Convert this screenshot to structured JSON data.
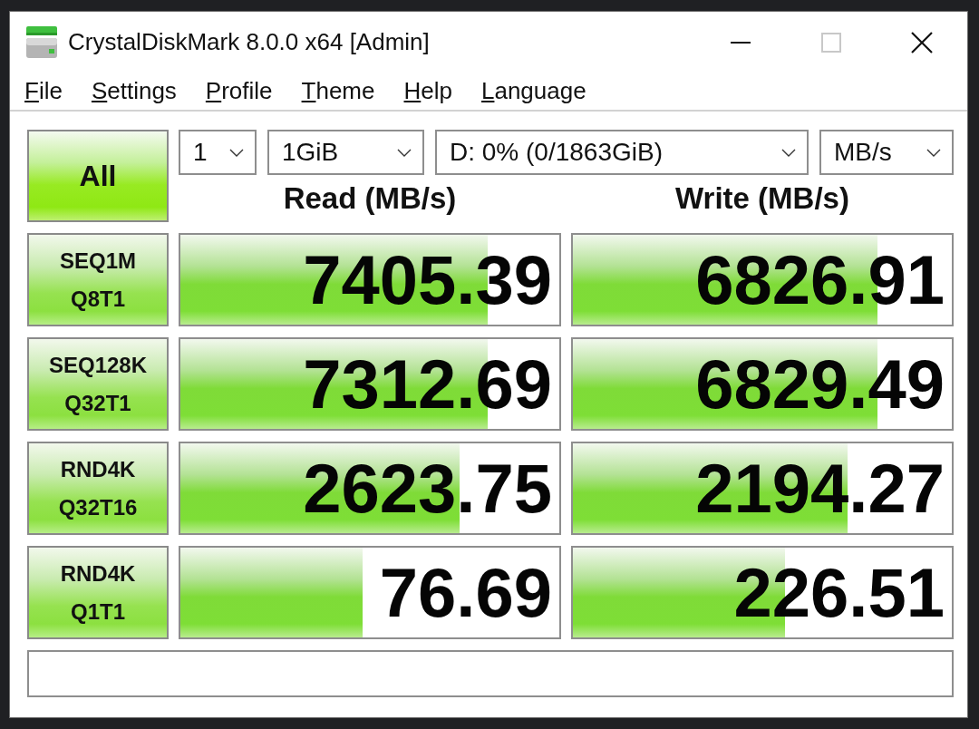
{
  "window": {
    "title": "CrystalDiskMark 8.0.0 x64 [Admin]",
    "controls": [
      {
        "kind": "minimize",
        "disabled": false
      },
      {
        "kind": "maximize",
        "disabled": true
      },
      {
        "kind": "close",
        "disabled": false
      }
    ]
  },
  "menu": [
    "File",
    "Settings",
    "Profile",
    "Theme",
    "Help",
    "Language"
  ],
  "toolbar": {
    "button": "All",
    "dropdowns": [
      {
        "value": "1"
      },
      {
        "value": "1GiB"
      },
      {
        "value": "D: 0% (0/1863GiB)"
      },
      {
        "value": "MB/s"
      }
    ]
  },
  "columns": [
    "Read (MB/s)",
    "Write (MB/s)"
  ],
  "tests": [
    {
      "label": "SEQ1M",
      "sublabel": "Q8T1",
      "read": {
        "value": "7405.39",
        "level": 0.81
      },
      "write": {
        "value": "6826.91",
        "level": 0.805
      }
    },
    {
      "label": "SEQ128K",
      "sublabel": "Q32T1",
      "read": {
        "value": "7312.69",
        "level": 0.81
      },
      "write": {
        "value": "6829.49",
        "level": 0.805
      }
    },
    {
      "label": "RND4K",
      "sublabel": "Q32T16",
      "read": {
        "value": "2623.75",
        "level": 0.737
      },
      "write": {
        "value": "2194.27",
        "level": 0.725
      }
    },
    {
      "label": "RND4K",
      "sublabel": "Q1T1",
      "read": {
        "value": "76.69",
        "level": 0.48
      },
      "write": {
        "value": "226.51",
        "level": 0.56
      }
    }
  ]
}
